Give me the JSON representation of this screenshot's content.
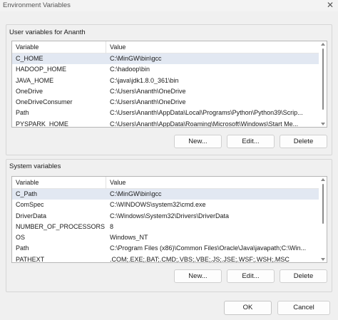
{
  "window": {
    "title": "Environment Variables",
    "close_glyph": "✕"
  },
  "user_section": {
    "label": "User variables for Ananth",
    "columns": {
      "variable": "Variable",
      "value": "Value"
    },
    "rows": [
      {
        "name": "C_HOME",
        "value": "C:\\MinGW\\bin\\gcc",
        "selected": true
      },
      {
        "name": "HADOOP_HOME",
        "value": "C:\\hadoop\\bin"
      },
      {
        "name": "JAVA_HOME",
        "value": "C:\\java\\jdk1.8.0_361\\bin"
      },
      {
        "name": "OneDrive",
        "value": "C:\\Users\\Ananth\\OneDrive"
      },
      {
        "name": "OneDriveConsumer",
        "value": "C:\\Users\\Ananth\\OneDrive"
      },
      {
        "name": "Path",
        "value": "C:\\Users\\Ananth\\AppData\\Local\\Programs\\Python\\Python39\\Scrip..."
      },
      {
        "name": "PYSPARK_HOME",
        "value": "C:\\Users\\Ananth\\AppData\\Roaming\\Microsoft\\Windows\\Start Me..."
      }
    ],
    "buttons": {
      "new": "New...",
      "edit": "Edit...",
      "delete": "Delete"
    }
  },
  "system_section": {
    "label": "System variables",
    "columns": {
      "variable": "Variable",
      "value": "Value"
    },
    "rows": [
      {
        "name": "C_Path",
        "value": "C:\\MinGW\\bin\\gcc",
        "selected": true
      },
      {
        "name": "ComSpec",
        "value": "C:\\WINDOWS\\system32\\cmd.exe"
      },
      {
        "name": "DriverData",
        "value": "C:\\Windows\\System32\\Drivers\\DriverData"
      },
      {
        "name": "NUMBER_OF_PROCESSORS",
        "value": "8"
      },
      {
        "name": "OS",
        "value": "Windows_NT"
      },
      {
        "name": "Path",
        "value": "C:\\Program Files (x86)\\Common Files\\Oracle\\Java\\javapath;C:\\Win..."
      },
      {
        "name": "PATHEXT",
        "value": ".COM;.EXE;.BAT;.CMD;.VBS;.VBE;.JS;.JSE;.WSF;.WSH;.MSC"
      }
    ],
    "buttons": {
      "new": "New...",
      "edit": "Edit...",
      "delete": "Delete"
    }
  },
  "footer": {
    "ok": "OK",
    "cancel": "Cancel"
  }
}
